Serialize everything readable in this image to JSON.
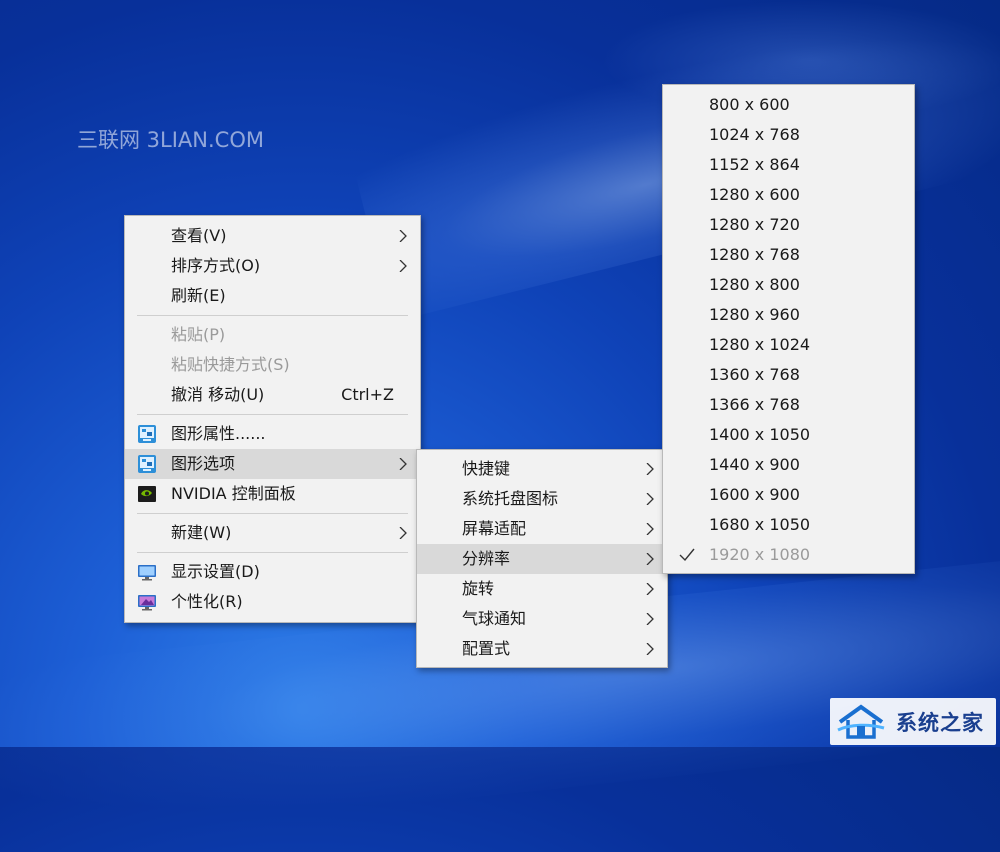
{
  "watermark": "三联网 3LIAN.COM",
  "context_menu": {
    "view": "查看(V)",
    "sort": "排序方式(O)",
    "refresh": "刷新(E)",
    "paste": "粘贴(P)",
    "paste_shortcut": "粘贴快捷方式(S)",
    "undo_move": "撤消 移动(U)",
    "undo_shortcut": "Ctrl+Z",
    "graphics_properties": "图形属性......",
    "graphics_options": "图形选项",
    "nvidia_panel": "NVIDIA 控制面板",
    "new": "新建(W)",
    "display_settings": "显示设置(D)",
    "personalize": "个性化(R)"
  },
  "graphics_submenu": {
    "items": [
      "快捷键",
      "系统托盘图标",
      "屏幕适配",
      "分辨率",
      "旋转",
      "气球通知",
      "配置式"
    ],
    "highlighted": "分辨率"
  },
  "resolution_menu": {
    "items": [
      "800 x 600",
      "1024 x 768",
      "1152 x 864",
      "1280 x 600",
      "1280 x 720",
      "1280 x 768",
      "1280 x 800",
      "1280 x 960",
      "1280 x 1024",
      "1360 x 768",
      "1366 x 768",
      "1400 x 1050",
      "1440 x 900",
      "1600 x 900",
      "1680 x 1050",
      "1920 x 1080"
    ],
    "current": "1920 x 1080"
  },
  "badge": {
    "text": "系统之家"
  },
  "icons": {
    "graphics_properties": "intel-graphics-icon",
    "graphics_options": "intel-graphics-icon",
    "nvidia_panel": "nvidia-icon",
    "display_settings": "monitor-icon",
    "personalize": "personalize-icon",
    "submenu": "chevron-right-icon",
    "selected": "checkmark-icon"
  },
  "colors": {
    "menu_background": "#f2f2f2",
    "highlight": "#d9d9d9",
    "disabled_text": "#9a9a9a",
    "desktop_blue": "#0f43b8"
  }
}
